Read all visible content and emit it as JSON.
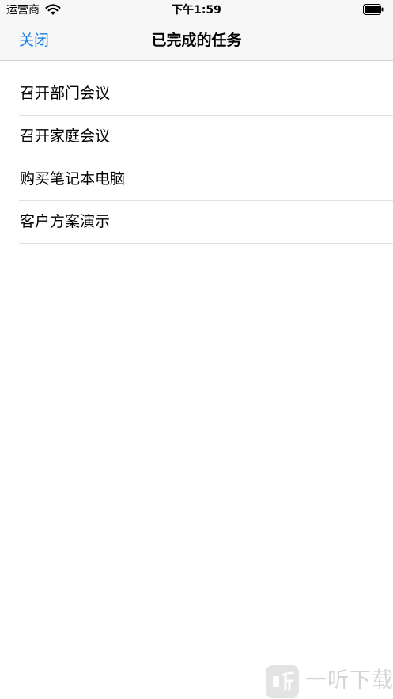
{
  "status_bar": {
    "carrier": "运营商",
    "time": "下午1:59"
  },
  "nav": {
    "close_label": "关闭",
    "title": "已完成的任务"
  },
  "tasks": [
    "召开部门会议",
    "召开家庭会议",
    "购买笔记本电脑",
    "客户方案演示"
  ],
  "watermark": {
    "text": "一听下载"
  },
  "colors": {
    "accent": "#1a7ee8",
    "nav_background": "#f7f7f7",
    "separator": "#e0e0e4"
  }
}
